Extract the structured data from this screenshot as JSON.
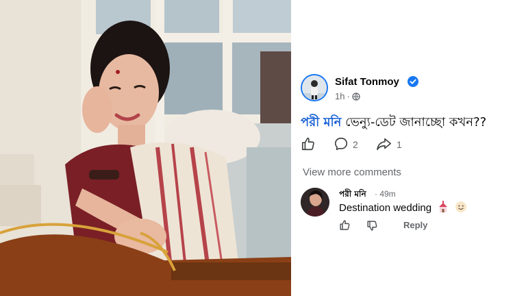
{
  "post": {
    "author": "Sifat Tonmoy",
    "time": "1h",
    "dot": "·",
    "mention": "পরী মনি",
    "text": " ভেন্যু-ডেট জানাচ্ছো কখন??",
    "comment_count": "2",
    "share_count": "1",
    "view_more": "View more comments"
  },
  "comment": {
    "author": "পরী মনি",
    "time": "· 49m",
    "text": "Destination wedding",
    "reply_label": "Reply"
  },
  "colors": {
    "accent": "#1877f2",
    "mention": "#1861d6",
    "muted": "#65676b",
    "text": "#050505"
  },
  "icons": {
    "verified": "verified-badge-icon",
    "audience": "globe-icon",
    "like": "thumbs-up-icon",
    "comment": "comment-bubble-icon",
    "share": "share-arrow-icon",
    "dislike": "thumbs-down-icon",
    "emoji_1": "wedding-chapel-emoji",
    "emoji_2": "smiling-face-emoji"
  }
}
